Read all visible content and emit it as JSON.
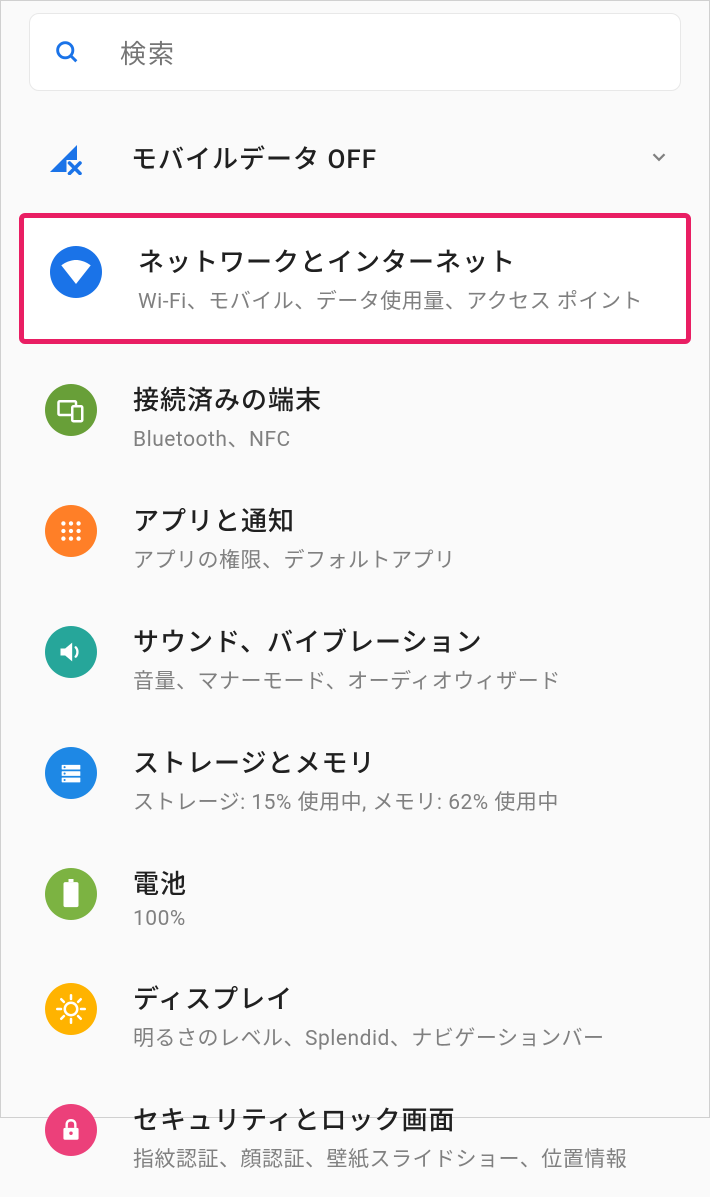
{
  "search": {
    "placeholder": "検索"
  },
  "mobile_data": {
    "label": "モバイルデータ OFF"
  },
  "settings": {
    "network": {
      "title": "ネットワークとインターネット",
      "subtitle": "Wi-Fi、モバイル、データ使用量、アクセス ポイント"
    },
    "connected": {
      "title": "接続済みの端末",
      "subtitle": "Bluetooth、NFC"
    },
    "apps": {
      "title": "アプリと通知",
      "subtitle": "アプリの権限、デフォルトアプリ"
    },
    "sound": {
      "title": "サウンド、バイブレーション",
      "subtitle": "音量、マナーモード、オーディオウィザード"
    },
    "storage": {
      "title": "ストレージとメモリ",
      "subtitle": "ストレージ: 15% 使用中, メモリ: 62% 使用中"
    },
    "battery": {
      "title": "電池",
      "subtitle": "100%"
    },
    "display": {
      "title": "ディスプレイ",
      "subtitle": "明るさのレベル、Splendid、ナビゲーションバー"
    },
    "security": {
      "title": "セキュリティとロック画面",
      "subtitle": "指紋認証、顔認証、壁紙スライドショー、位置情報"
    }
  }
}
